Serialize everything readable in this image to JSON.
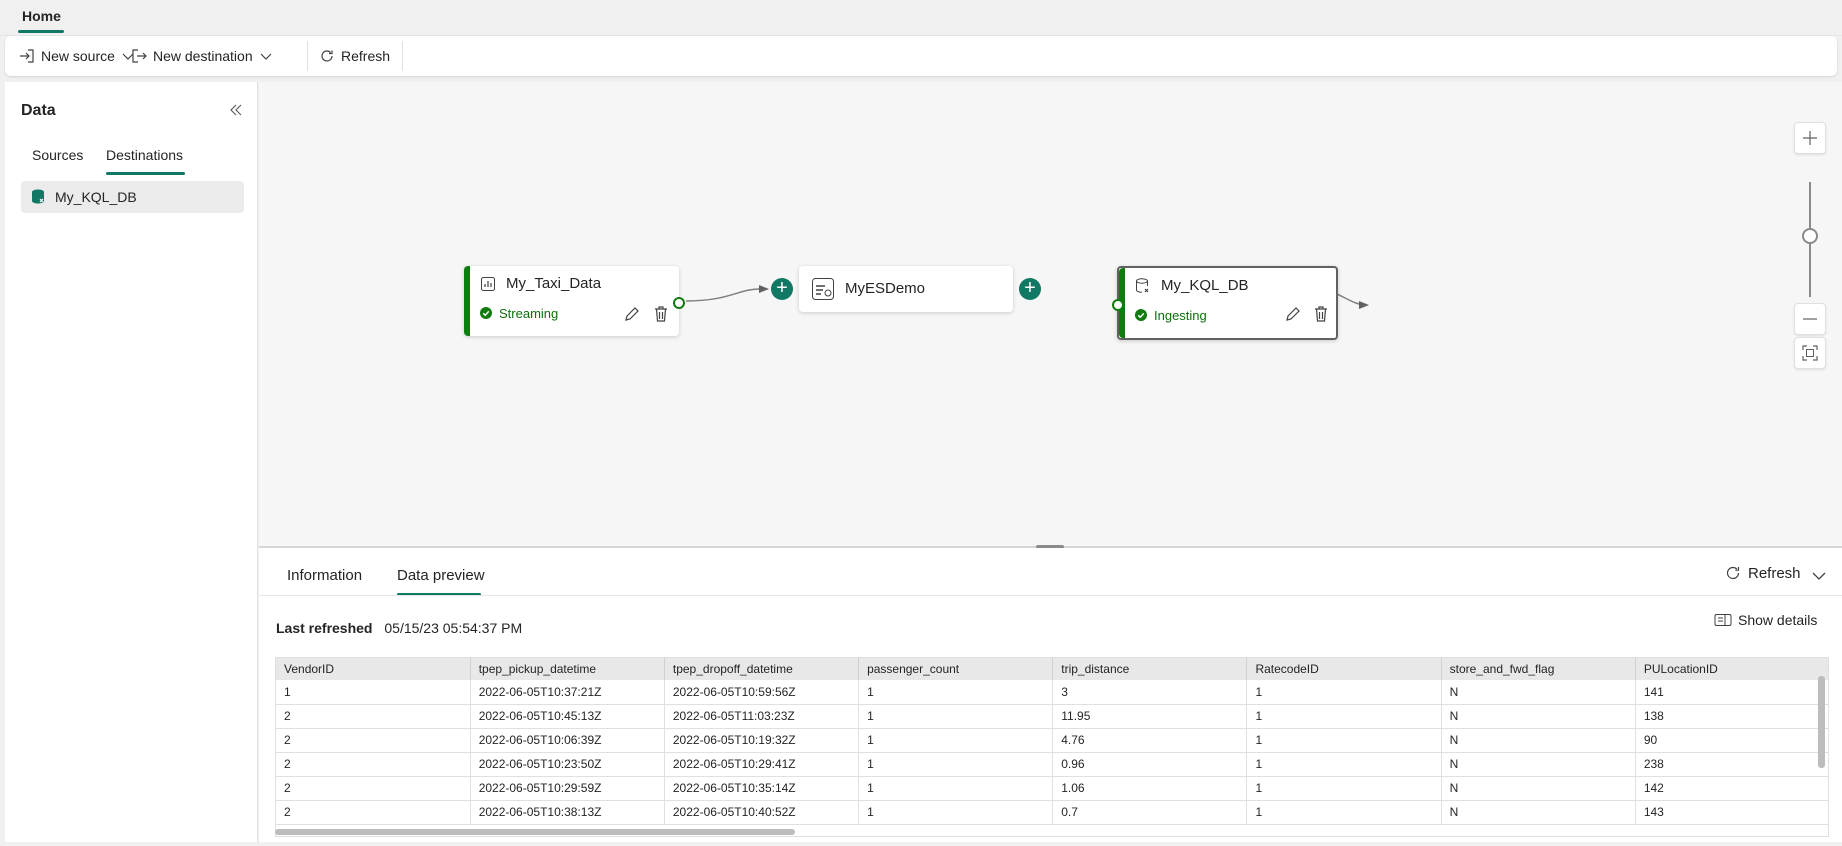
{
  "top_tab": {
    "label": "Home"
  },
  "toolbar": {
    "new_source": "New source",
    "new_destination": "New destination",
    "refresh": "Refresh"
  },
  "left_panel": {
    "title": "Data",
    "tabs": [
      "Sources",
      "Destinations"
    ],
    "active_tab": "Destinations",
    "items": [
      {
        "label": "My_KQL_DB",
        "icon": "kql-database-icon"
      }
    ]
  },
  "canvas": {
    "nodes": [
      {
        "title": "My_Taxi_Data",
        "status": "Streaming",
        "icon": "chart-icon"
      },
      {
        "title": "MyESDemo",
        "icon": "eventstream-icon"
      },
      {
        "title": "My_KQL_DB",
        "status": "Ingesting",
        "icon": "kql-database-icon"
      }
    ]
  },
  "bottom_panel": {
    "tabs": [
      "Information",
      "Data preview"
    ],
    "active_tab": "Data preview",
    "refresh": "Refresh",
    "last_refreshed_label": "Last refreshed",
    "last_refreshed_value": "05/15/23 05:54:37 PM",
    "show_details": "Show details"
  },
  "table": {
    "columns": [
      "VendorID",
      "tpep_pickup_datetime",
      "tpep_dropoff_datetime",
      "passenger_count",
      "trip_distance",
      "RatecodeID",
      "store_and_fwd_flag",
      "PULocationID"
    ],
    "rows": [
      [
        "1",
        "2022-06-05T10:37:21Z",
        "2022-06-05T10:59:56Z",
        "1",
        "3",
        "1",
        "N",
        "141"
      ],
      [
        "2",
        "2022-06-05T10:45:13Z",
        "2022-06-05T11:03:23Z",
        "1",
        "11.95",
        "1",
        "N",
        "138"
      ],
      [
        "2",
        "2022-06-05T10:06:39Z",
        "2022-06-05T10:19:32Z",
        "1",
        "4.76",
        "1",
        "N",
        "90"
      ],
      [
        "2",
        "2022-06-05T10:23:50Z",
        "2022-06-05T10:29:41Z",
        "1",
        "0.96",
        "1",
        "N",
        "238"
      ],
      [
        "2",
        "2022-06-05T10:29:59Z",
        "2022-06-05T10:35:14Z",
        "1",
        "1.06",
        "1",
        "N",
        "142"
      ],
      [
        "2",
        "2022-06-05T10:38:13Z",
        "2022-06-05T10:40:52Z",
        "1",
        "0.7",
        "1",
        "N",
        "143"
      ]
    ]
  },
  "colors": {
    "accent": "#117865",
    "status_green": "#107c10"
  }
}
